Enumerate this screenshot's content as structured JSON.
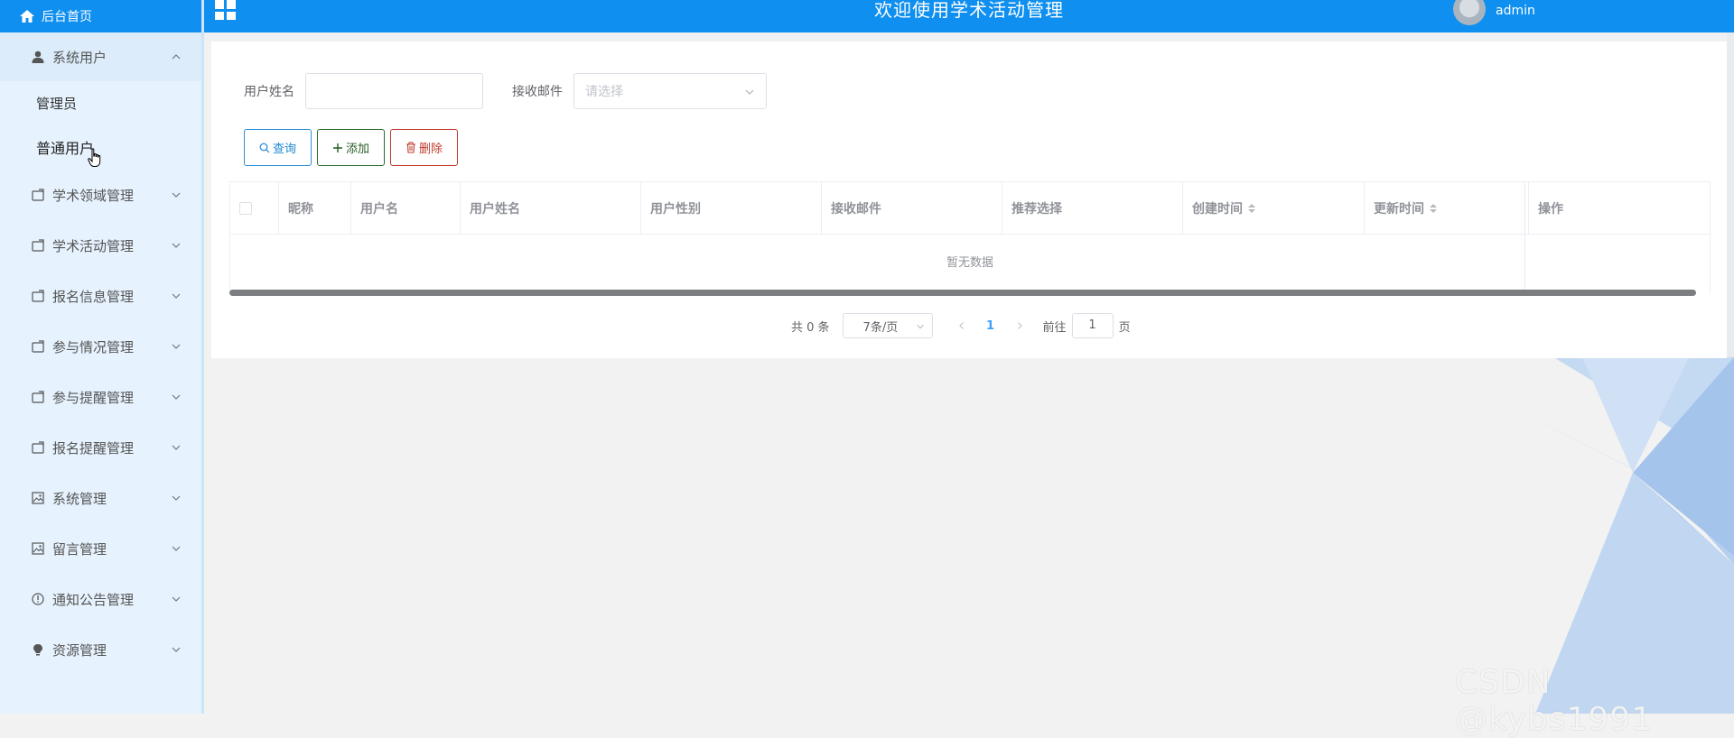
{
  "sidebar": {
    "home": "后台首页",
    "groups": [
      {
        "label": "系统用户",
        "icon": "user-icon",
        "open": true
      },
      {
        "label": "学术领域管理",
        "icon": "folder-icon"
      },
      {
        "label": "学术活动管理",
        "icon": "folder-icon"
      },
      {
        "label": "报名信息管理",
        "icon": "folder-icon"
      },
      {
        "label": "参与情况管理",
        "icon": "folder-icon"
      },
      {
        "label": "参与提醒管理",
        "icon": "folder-icon"
      },
      {
        "label": "报名提醒管理",
        "icon": "folder-icon"
      },
      {
        "label": "系统管理",
        "icon": "picture-icon"
      },
      {
        "label": "留言管理",
        "icon": "picture-icon"
      },
      {
        "label": "通知公告管理",
        "icon": "info-icon"
      },
      {
        "label": "资源管理",
        "icon": "bulb-icon"
      }
    ],
    "sub_items": [
      "管理员",
      "普通用户"
    ]
  },
  "header": {
    "title": "欢迎使用学术活动管理",
    "username": "admin"
  },
  "filters": {
    "name_label": "用户姓名",
    "name_value": "",
    "email_label": "接收邮件",
    "email_placeholder": "请选择"
  },
  "buttons": {
    "query": "查询",
    "add": "添加",
    "delete": "删除"
  },
  "table": {
    "columns": [
      "昵称",
      "用户名",
      "用户姓名",
      "用户性别",
      "接收邮件",
      "推荐选择",
      "创建时间",
      "更新时间",
      "操作"
    ],
    "empty_text": "暂无数据"
  },
  "pagination": {
    "total": "共 0 条",
    "page_size": "7条/页",
    "current_page": "1",
    "goto_label": "前往",
    "goto_value": "1",
    "page_suffix": "页"
  },
  "watermark": "CSDN @kybs1991",
  "colors": {
    "primary": "#0f8fef",
    "sidebar_bg": "#e6f2fd",
    "decor": "#9ec3ee"
  }
}
